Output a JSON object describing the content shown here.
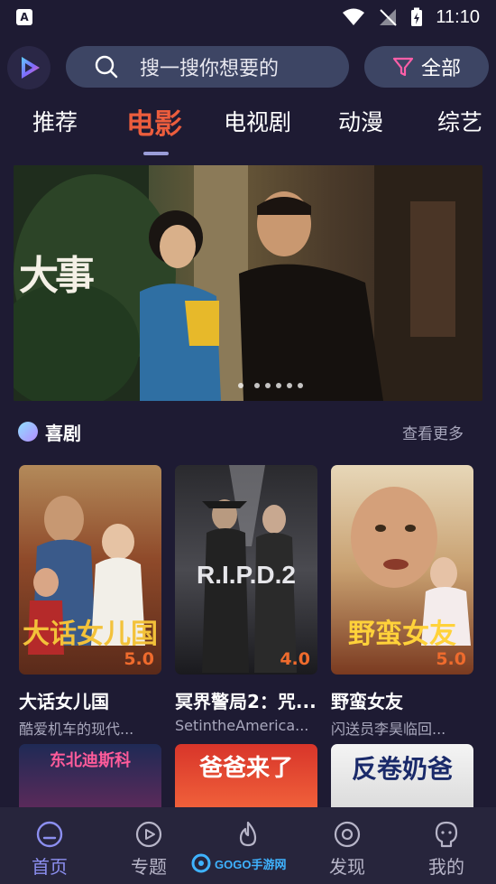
{
  "status_bar": {
    "app_icon_letter": "A",
    "time": "11:10"
  },
  "header": {
    "search_placeholder": "搜一搜你想要的",
    "filter_label": "全部"
  },
  "tabs": [
    {
      "label": "推荐",
      "active": false
    },
    {
      "label": "电影",
      "active": true
    },
    {
      "label": "电视剧",
      "active": false
    },
    {
      "label": "动漫",
      "active": false
    },
    {
      "label": "综艺",
      "active": false
    }
  ],
  "banner": {
    "title_art": "大事",
    "page_count": 6,
    "current_page": 1
  },
  "section": {
    "title": "喜剧",
    "more_label": "查看更多"
  },
  "movies": [
    {
      "name": "大话女儿国",
      "desc": "酷爱机车的现代...",
      "score": "5.0",
      "poster_art": "大话女儿国"
    },
    {
      "name": "冥界警局2：咒...",
      "desc": "SetintheAmerica...",
      "score": "4.0",
      "poster_art": "R.I.P.D.2"
    },
    {
      "name": "野蛮女友",
      "desc": "闪送员李昊临回...",
      "score": "5.0",
      "poster_art": "野蛮女友"
    }
  ],
  "next_row_posters": [
    {
      "art": "东北迪斯科"
    },
    {
      "art": "爸爸来了"
    },
    {
      "art": "反卷奶爸"
    }
  ],
  "bottom_nav": [
    {
      "label": "首页",
      "active": true,
      "icon": "home-icon"
    },
    {
      "label": "专题",
      "active": false,
      "icon": "play-circle-icon"
    },
    {
      "label": "",
      "active": false,
      "icon": "flame-icon"
    },
    {
      "label": "发现",
      "active": false,
      "icon": "target-icon"
    },
    {
      "label": "我的",
      "active": false,
      "icon": "profile-icon"
    }
  ],
  "watermark": "GOGO手游网",
  "colors": {
    "background": "#1e1b33",
    "accent_active_tab": "#ec5d3d",
    "score": "#ef6b2d",
    "nav_active": "#8c8ff0"
  }
}
